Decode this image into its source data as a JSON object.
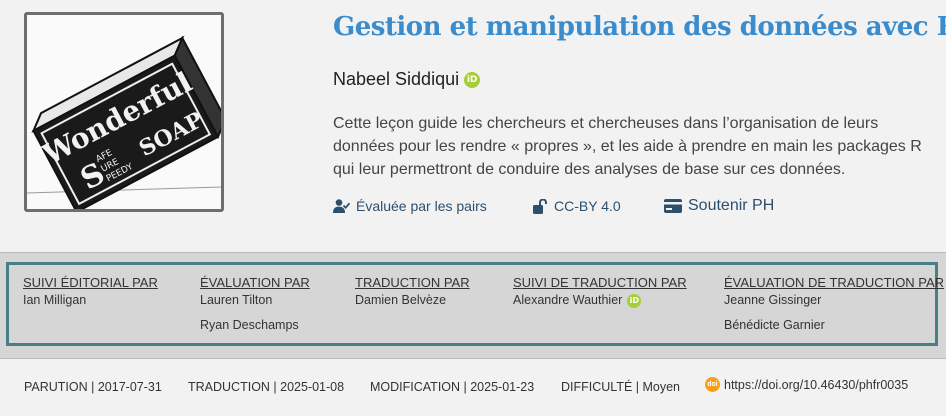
{
  "lesson": {
    "title": "Gestion et manipulation des données avec R",
    "author": "Nabeel Siddiqui",
    "abstract": "Cette leçon guide les chercheurs et chercheuses dans l’organisation de leurs données pour les rendre « propres », et les aide à prendre en main les packages R qui leur permettront de conduire des analyses de base sur ces données.",
    "image_text": {
      "line1": "Wonderful",
      "line2": "SOAP",
      "words": [
        "AFE",
        "URE",
        "PEEDY"
      ],
      "initial": "S"
    }
  },
  "badges": {
    "peer_review": "Évaluée par les pairs",
    "license": "CC-BY 4.0",
    "support": "Soutenir PH"
  },
  "credits": [
    {
      "heading": "SUIVI ÉDITORIAL PAR",
      "names": [
        "Ian Milligan"
      ]
    },
    {
      "heading": "ÉVALUATION PAR",
      "names": [
        "Lauren Tilton",
        "Ryan Deschamps"
      ]
    },
    {
      "heading": "TRADUCTION PAR",
      "names": [
        "Damien Belvèze"
      ]
    },
    {
      "heading": "SUIVI DE TRADUCTION PAR",
      "names": [
        "Alexandre Wauthier"
      ]
    },
    {
      "heading": "ÉVALUATION DE TRADUCTION PAR",
      "names": [
        "Jeanne Gissinger",
        "Bénédicte Garnier"
      ]
    }
  ],
  "meta": {
    "published": "PARUTION | 2017-07-31",
    "translated": "TRADUCTION | 2025-01-08",
    "modified": "MODIFICATION | 2025-01-23",
    "difficulty": "DIFFICULTÉ | Moyen",
    "doi": "https://doi.org/10.46430/phfr0035"
  },
  "icons": {
    "orcid": "orcid-icon",
    "peer_review": "user-check-icon",
    "license": "unlock-icon",
    "support": "credit-card-icon",
    "doi": "doi-icon"
  },
  "colors": {
    "title": "#3a8ccc",
    "orcid": "#a6ce39",
    "credits_border": "#4b7f86",
    "doi": "#f6a01a"
  }
}
